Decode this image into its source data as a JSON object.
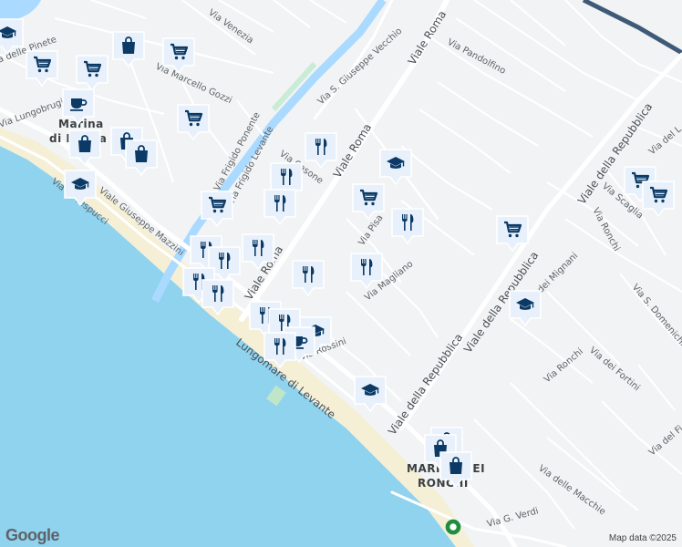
{
  "attribution": "Map data ©2025",
  "logo": "Google",
  "colors": {
    "sea": "#8fd3ee",
    "beach": "#f5efd6",
    "land": "#f1f3f4",
    "road": "#ffffff",
    "canal": "#aadaff",
    "motorway": "#3f5a78",
    "marker": "#0b3a66",
    "marker_bg": "#e8f1fb"
  },
  "places": [
    {
      "id": "marina-di-massa",
      "lines": [
        "Marina",
        "di Massa"
      ]
    },
    {
      "id": "marina-dei-ronchi",
      "lines": [
        "MARINA DEI",
        "RONCHI"
      ]
    }
  ],
  "roads": [
    {
      "id": "viale-roma-north",
      "label": "Viale Roma",
      "major": true
    },
    {
      "id": "viale-roma-mid",
      "label": "Viale Roma",
      "major": true
    },
    {
      "id": "viale-roma-south",
      "label": "Viale Roma",
      "major": true
    },
    {
      "id": "viale-repubblica-1",
      "label": "Viale della Repubblica",
      "major": true
    },
    {
      "id": "viale-repubblica-2",
      "label": "Viale della Repubblica",
      "major": true
    },
    {
      "id": "viale-repubblica-3",
      "label": "Viale della Repubblica",
      "major": true
    },
    {
      "id": "lungomare-levante",
      "label": "Lungomare di Levante",
      "major": true
    },
    {
      "id": "via-vespucci",
      "label": "Via A. Vespucci",
      "major": false
    },
    {
      "id": "via-mazzini",
      "label": "Viale Giuseppe Mazzini",
      "major": false
    },
    {
      "id": "via-venezia",
      "label": "Via Venezia",
      "major": false
    },
    {
      "id": "via-gozzi",
      "label": "Via Marcello Gozzi",
      "major": false
    },
    {
      "id": "via-vecchio",
      "label": "Via S. Giuseppe Vecchio",
      "major": false
    },
    {
      "id": "via-pandolfino",
      "label": "Via Pandolfino",
      "major": false
    },
    {
      "id": "frigido-ponente",
      "label": "Via Frigido Ponente",
      "major": false
    },
    {
      "id": "frigido-levante",
      "label": "Via Frigido Levante",
      "major": false
    },
    {
      "id": "via-pinete",
      "label": "Via delle Pinete",
      "major": false
    },
    {
      "id": "via-lungobrugiano",
      "label": "Via Lungobrugiano",
      "major": false
    },
    {
      "id": "via-casone",
      "label": "Via Casone",
      "major": false
    },
    {
      "id": "via-pisa",
      "label": "Via Pisa",
      "major": false
    },
    {
      "id": "via-magliano",
      "label": "Via Magliano",
      "major": false
    },
    {
      "id": "via-rossini",
      "label": "Via Rossini",
      "major": false
    },
    {
      "id": "via-mignani",
      "label": "Via dei Mignani",
      "major": false
    },
    {
      "id": "via-ronchi-1",
      "label": "Via Ronchi",
      "major": false
    },
    {
      "id": "via-ronchi-2",
      "label": "Via Ronchi",
      "major": false
    },
    {
      "id": "via-fortini",
      "label": "Via dei Fortini",
      "major": false
    },
    {
      "id": "via-domenichino",
      "label": "Via S. Domenichino",
      "major": false
    },
    {
      "id": "via-macchie",
      "label": "Via delle Macchie",
      "major": false
    },
    {
      "id": "via-verdi",
      "label": "Via G. Verdi",
      "major": false
    },
    {
      "id": "via-scaglia",
      "label": "Via Scaglia",
      "major": false
    },
    {
      "id": "via-del-l",
      "label": "Via del L",
      "major": false
    },
    {
      "id": "via-del-fi",
      "label": "Via del Fi",
      "major": false
    }
  ],
  "pois": [
    {
      "id": "p1",
      "type": "school"
    },
    {
      "id": "p2",
      "type": "shopping-cart"
    },
    {
      "id": "p3",
      "type": "shopping-cart"
    },
    {
      "id": "p4",
      "type": "shopping-bag"
    },
    {
      "id": "p5",
      "type": "shopping-cart"
    },
    {
      "id": "p6",
      "type": "coffee"
    },
    {
      "id": "p7",
      "type": "shopping-cart"
    },
    {
      "id": "p8",
      "type": "shopping-bag"
    },
    {
      "id": "p9",
      "type": "shopping-bag"
    },
    {
      "id": "p10",
      "type": "shopping-bag"
    },
    {
      "id": "p11",
      "type": "school"
    },
    {
      "id": "p12",
      "type": "restaurant"
    },
    {
      "id": "p13",
      "type": "restaurant"
    },
    {
      "id": "p14",
      "type": "school"
    },
    {
      "id": "p15",
      "type": "restaurant"
    },
    {
      "id": "p16",
      "type": "shopping-cart"
    },
    {
      "id": "p17",
      "type": "shopping-cart"
    },
    {
      "id": "p18",
      "type": "restaurant"
    },
    {
      "id": "p19",
      "type": "shopping-cart"
    },
    {
      "id": "p20",
      "type": "restaurant"
    },
    {
      "id": "p21",
      "type": "restaurant"
    },
    {
      "id": "p22",
      "type": "restaurant"
    },
    {
      "id": "p23",
      "type": "restaurant"
    },
    {
      "id": "p24",
      "type": "restaurant"
    },
    {
      "id": "p25",
      "type": "restaurant"
    },
    {
      "id": "p26",
      "type": "school"
    },
    {
      "id": "p27",
      "type": "shopping-cart"
    },
    {
      "id": "p28",
      "type": "shopping-cart"
    },
    {
      "id": "p29",
      "type": "restaurant"
    },
    {
      "id": "p30",
      "type": "restaurant"
    },
    {
      "id": "p31",
      "type": "restaurant"
    },
    {
      "id": "p32",
      "type": "school"
    },
    {
      "id": "p33",
      "type": "coffee"
    },
    {
      "id": "p34",
      "type": "restaurant"
    },
    {
      "id": "p35",
      "type": "school"
    },
    {
      "id": "p36",
      "type": "shopping-bag"
    },
    {
      "id": "p37",
      "type": "shopping-bag"
    },
    {
      "id": "p38",
      "type": "shopping-bag"
    },
    {
      "id": "p39",
      "type": "transit"
    }
  ]
}
